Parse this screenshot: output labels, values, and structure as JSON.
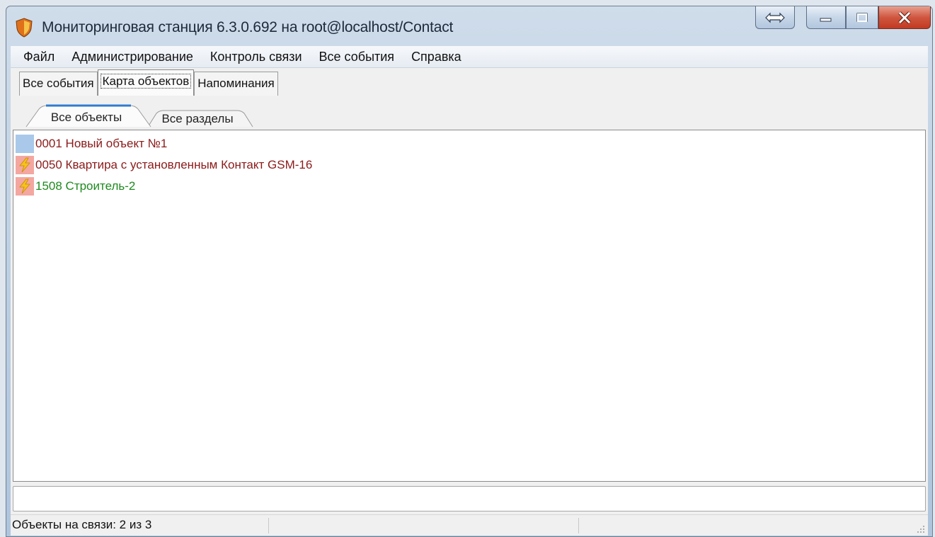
{
  "window": {
    "title": "Мониторинговая станция 6.3.0.692 на root@localhost/Contact"
  },
  "menu": [
    "Файл",
    "Администрирование",
    "Контроль связи",
    "Все события",
    "Справка"
  ],
  "tabs": [
    "Все события",
    "Карта объектов",
    "Напоминания"
  ],
  "active_tab": "Карта объектов",
  "subtabs": [
    "Все объекты",
    "Все разделы"
  ],
  "active_subtab": "Все объекты",
  "objects": [
    {
      "label": "0001 Новый объект №1",
      "color": "#8b1a1a",
      "icon": "square-icon"
    },
    {
      "label": "0050 Квартира с установленным Контакт GSM-16",
      "color": "#8b1a1a",
      "icon": "lightning-icon"
    },
    {
      "label": "1508 Строитель-2",
      "color": "#1e8a1e",
      "icon": "lightning-icon"
    }
  ],
  "input": {
    "value": ""
  },
  "status": {
    "text": "Объекты на связи: 2 из 3"
  }
}
